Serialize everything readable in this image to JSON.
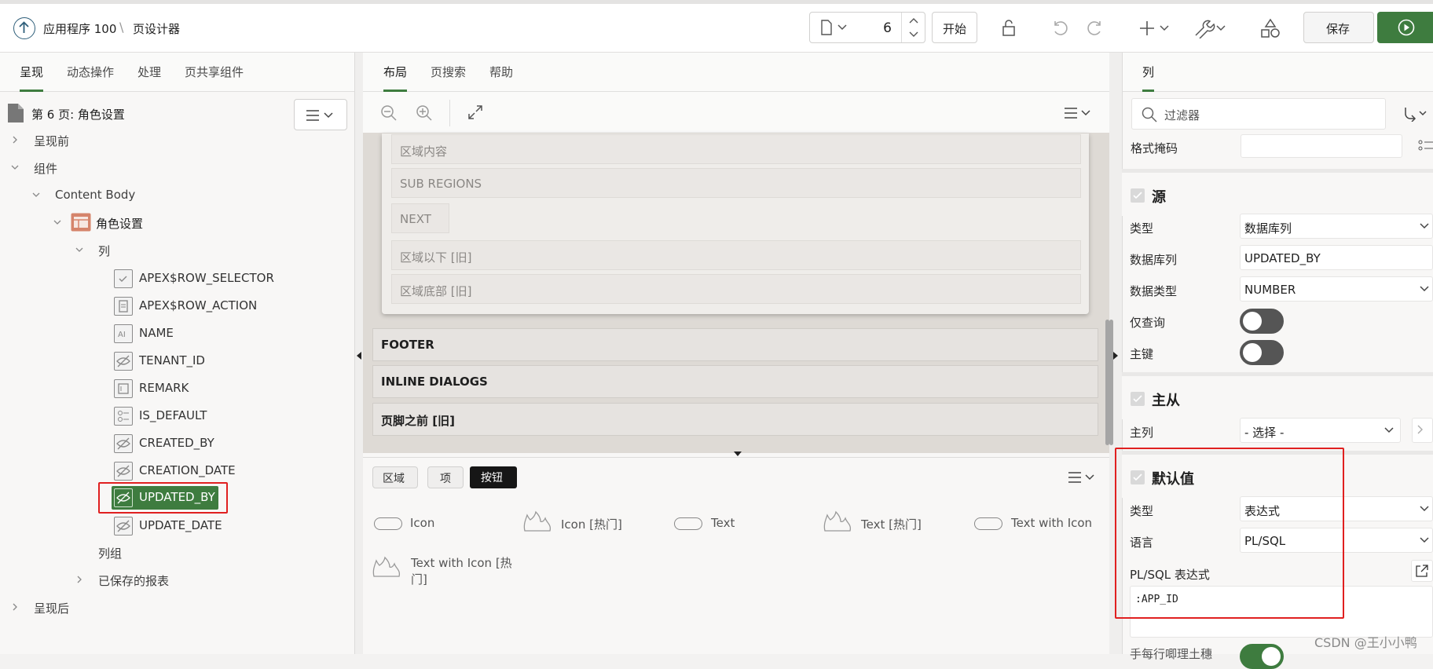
{
  "topbar": {
    "app_label": "应用程序 100",
    "separator": "\\",
    "page_designer": "页设计器",
    "page_number": "6",
    "start_label": "开始",
    "save_label": "保存"
  },
  "left": {
    "tabs": [
      "呈现",
      "动态操作",
      "处理",
      "页共享组件"
    ],
    "page_title": "第 6 页: 角色设置",
    "tree": {
      "before": "呈现前",
      "components": "组件",
      "content_body": "Content Body",
      "region": "角色设置",
      "columns_label": "列",
      "columns": [
        "APEX$ROW_SELECTOR",
        "APEX$ROW_ACTION",
        "NAME",
        "TENANT_ID",
        "REMARK",
        "IS_DEFAULT",
        "CREATED_BY",
        "CREATION_DATE",
        "UPDATED_BY",
        "UPDATE_DATE"
      ],
      "col_groups": "列组",
      "saved_reports": "已保存的报表",
      "after": "呈现后"
    }
  },
  "mid": {
    "tabs": [
      "布局",
      "页搜索",
      "帮助"
    ],
    "layout_rows": [
      "区域内容",
      "SUB REGIONS",
      "NEXT",
      "区域以下 [旧]",
      "区域底部 [旧]"
    ],
    "bottom_regions": [
      "FOOTER",
      "INLINE DIALOGS",
      "页脚之前 [旧]"
    ],
    "gallery_tabs": [
      "区域",
      "项",
      "按钮"
    ],
    "gallery_items": [
      "Icon",
      "Icon [热门]",
      "Text",
      "Text [热门]",
      "Text with Icon",
      "Text with Icon [热",
      "门]"
    ]
  },
  "right": {
    "tab": "列",
    "filter_placeholder": "过滤器",
    "format_mask": "格式掩码",
    "source": {
      "title": "源",
      "type_label": "类型",
      "type_value": "数据库列",
      "dbcol_label": "数据库列",
      "dbcol_value": "UPDATED_BY",
      "dtype_label": "数据类型",
      "dtype_value": "NUMBER",
      "query_only": "仅查询",
      "primary_key": "主键"
    },
    "master": {
      "title": "主从",
      "col_label": "主列",
      "col_value": "- 选择 -"
    },
    "default": {
      "title": "默认值",
      "type_label": "类型",
      "type_value": "表达式",
      "lang_label": "语言",
      "lang_value": "PL/SQL",
      "expr_label": "PL/SQL 表达式",
      "expr_value": ":APP_ID"
    },
    "cut_label": "手每行唧理土穗"
  },
  "watermark": "CSDN @王小小鸭",
  "colors": {
    "accent": "#3e7c3f",
    "highlight": "#e02020"
  }
}
